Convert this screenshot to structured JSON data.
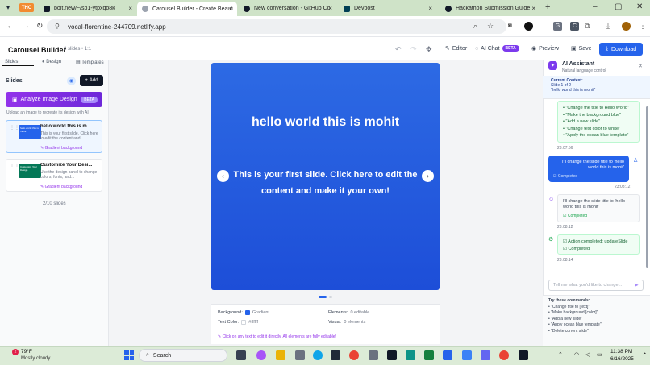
{
  "browser": {
    "thc_badge": "THC",
    "tabs": [
      {
        "title": "bolt.new/~/sb1-ytpxqo8k",
        "favicon_color": "#111827"
      },
      {
        "title": "Carousel Builder - Create Beautif",
        "favicon_color": "#6b7280"
      },
      {
        "title": "New conversation - GitHub Co",
        "favicon_color": "#111827"
      },
      {
        "title": "Devpost",
        "favicon_color": "#003e54"
      },
      {
        "title": "Hackathon Submission Guide",
        "favicon_color": "#111827"
      }
    ],
    "url": "vocal-florentine-244709.netlify.app"
  },
  "app": {
    "title": "Carousel Builder",
    "slide_meta": "2 slides • 1:1",
    "editor_label": "Editor",
    "ai_chat_label": "AI Chat",
    "beta": "BETA",
    "preview_label": "Preview",
    "save_label": "Save",
    "download_label": "Download"
  },
  "sidebar": {
    "tabs": [
      "Slides",
      "Design",
      "Templates"
    ],
    "heading": "Slides",
    "add_label": "Add",
    "analyze_label": "Analyze Image Design",
    "analyze_beta": "BETA",
    "analyze_hint": "Upload an image to recreate its design with AI",
    "slides": [
      {
        "title": "hello world this is m...",
        "desc": "This is your first slide. Click here to edit the content and...",
        "badge": "✎ Gradient background",
        "thumb_text": "hello world this is mohit",
        "thumb_color": "#2563eb"
      },
      {
        "title": "Customize Your Desi...",
        "desc": "Use the design panel to change colors, fonts, and...",
        "badge": "✎ Gradient background",
        "thumb_text": "Customize Your Design",
        "thumb_color": "#047857"
      }
    ],
    "count": "2/10 slides"
  },
  "slide": {
    "title": "hello world this is mohit",
    "body": "This is your first slide. Click here to edit the content and make it your own!",
    "prev": "‹",
    "next": "›"
  },
  "properties": {
    "background_label": "Background:",
    "background_value": "Gradient",
    "text_color_label": "Text Color:",
    "text_color_value": "#ffffff",
    "elements_label": "Elements:",
    "elements_value": "0 editable",
    "visual_label": "Visual:",
    "visual_value": "0 elements",
    "hint": "✎ Click on any text to edit it directly. All elements are fully editable!"
  },
  "ai": {
    "title": "AI Assistant",
    "subtitle": "Natural language control",
    "context_label": "Current Context:",
    "context_line1": "Slide 1 of 2",
    "context_line2": "\"hello world this is mohit\"",
    "commands": [
      "• \"Change the title to Hello World\"",
      "• \"Make the background blue\"",
      "• \"Add a new slide\"",
      "• \"Change text color to white\"",
      "• \"Apply the ocean blue template\""
    ],
    "ts1": "23:07:56",
    "user_msg": "I'll change the slide title to 'hello world this is mohit'",
    "user_completed": "☑ Completed",
    "ts2": "23:08:12",
    "bot_msg": "I'll change the slide title to 'hello world this is mohit'",
    "bot_completed": "☑ Completed",
    "ts3": "23:08:12",
    "action_msg": "☑ Action completed: updateSlide",
    "action_completed": "☑ Completed",
    "ts4": "23:08:14",
    "input_placeholder": "Tell me what you'd like to change...",
    "try_label": "Try these commands:",
    "try_items": [
      "• \"Change title to [text]\"",
      "• \"Make background [color]\"",
      "• \"Add a new slide\"",
      "• \"Apply ocean blue template\"",
      "• \"Delete current slide\""
    ]
  },
  "taskbar": {
    "weather_badge": "2",
    "temp": "79°F",
    "weather": "Mostly cloudy",
    "search": "Search",
    "time": "11:38 PM",
    "date": "6/16/2025"
  }
}
